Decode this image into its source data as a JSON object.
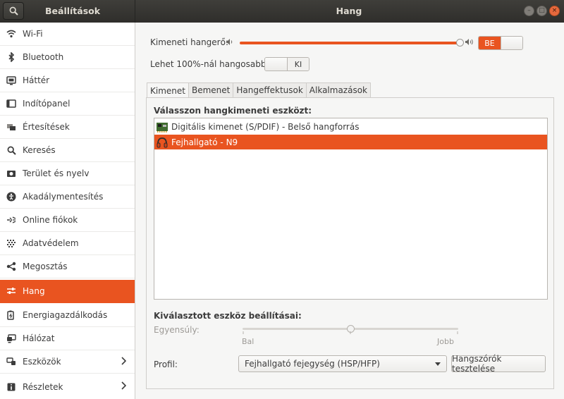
{
  "titlebar": {
    "sidebar_title": "Beállítások",
    "title": "Hang",
    "window_buttons": [
      "minimize",
      "maximize",
      "close"
    ]
  },
  "sidebar": {
    "items": [
      {
        "label": "Wi-Fi",
        "icon": "wifi-icon"
      },
      {
        "label": "Bluetooth",
        "icon": "bluetooth-icon"
      },
      {
        "label": "Háttér",
        "icon": "background-icon"
      },
      {
        "label": "Indítópanel",
        "icon": "dock-icon"
      },
      {
        "label": "Értesítések",
        "icon": "notifications-icon"
      },
      {
        "label": "Keresés",
        "icon": "search-icon"
      },
      {
        "label": "Terület és nyelv",
        "icon": "region-icon"
      },
      {
        "label": "Akadálymentesítés",
        "icon": "accessibility-icon"
      },
      {
        "label": "Online fiókok",
        "icon": "online-accounts-icon"
      },
      {
        "label": "Adatvédelem",
        "icon": "privacy-icon"
      },
      {
        "label": "Megosztás",
        "icon": "share-icon"
      },
      {
        "label": "Hang",
        "icon": "sound-icon",
        "active": true
      },
      {
        "label": "Energiagazdálkodás",
        "icon": "power-icon"
      },
      {
        "label": "Hálózat",
        "icon": "network-icon"
      },
      {
        "label": "Eszközök",
        "icon": "devices-icon",
        "chevron": true
      },
      {
        "label": "Részletek",
        "icon": "details-icon",
        "chevron": true
      }
    ]
  },
  "output_volume": {
    "label": "Kimeneti hangerő:",
    "level": 0.97,
    "switch_on_label": "BE"
  },
  "amplify": {
    "label": "Lehet 100%-nál hangosabb",
    "switch_off_label": "KI"
  },
  "tabs": [
    "Kimenet",
    "Bemenet",
    "Hangeffektusok",
    "Alkalmazások"
  ],
  "output_panel": {
    "heading": "Válasszon hangkimeneti eszközt:",
    "devices": [
      {
        "label": "Digitális kimenet (S/PDIF) - Belső hangforrás",
        "icon": "pci-card-icon",
        "selected": false
      },
      {
        "label": "Fejhallgató - N9",
        "icon": "headphones-icon",
        "selected": true
      }
    ],
    "settings_heading": "Kiválasztott eszköz beállításai:",
    "balance": {
      "label": "Egyensúly:",
      "left": "Bal",
      "right": "Jobb",
      "value": 0.5
    },
    "profile": {
      "label": "Profil:",
      "value": "Fejhallgató fejegység (HSP/HFP)"
    },
    "test_button": "Hangszórók tesztelése"
  },
  "colors": {
    "accent": "#e95420",
    "titlebar": "#3c3b37",
    "background": "#f6f6f5"
  }
}
